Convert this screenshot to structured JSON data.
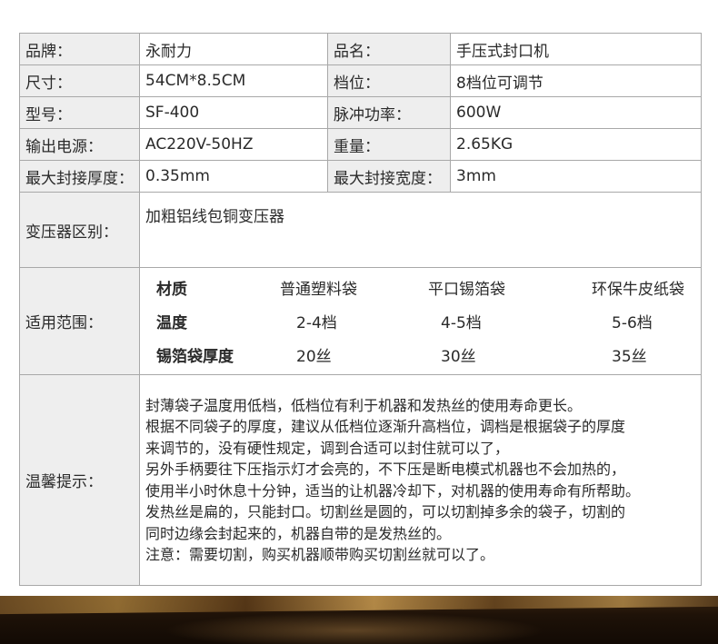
{
  "specs": {
    "rows": [
      {
        "label1": "品牌：",
        "value1": "永耐力",
        "label2": "品名：",
        "value2": "手压式封口机"
      },
      {
        "label1": "尺寸：",
        "value1": "54CM*8.5CM",
        "label2": "档位：",
        "value2": "8档位可调节"
      },
      {
        "label1": "型号：",
        "value1": "SF-400",
        "label2": "脉冲功率：",
        "value2": "600W"
      },
      {
        "label1": "输出电源：",
        "value1": "AC220V-50HZ",
        "label2": "重量：",
        "value2": "2.65KG"
      },
      {
        "label1": "最大封接厚度：",
        "value1": "0.35mm",
        "label2": "最大封接宽度：",
        "value2": "3mm"
      }
    ],
    "transformer": {
      "label": "变压器区别：",
      "value": "加粗铝线包铜变压器"
    },
    "range": {
      "label": "适用范围：",
      "header": [
        "材质",
        "普通塑料袋",
        "平口锡箔袋",
        "环保牛皮纸袋"
      ],
      "temp": [
        "温度",
        "2-4档",
        "4-5档",
        "5-6档"
      ],
      "thickness": [
        "锡箔袋厚度",
        "20丝",
        "30丝",
        "35丝"
      ]
    },
    "tips": {
      "label": "温馨提示：",
      "lines": [
        "封薄袋子温度用低档，低档位有利于机器和发热丝的使用寿命更长。",
        "根据不同袋子的厚度，建议从低档位逐渐升高档位，调档是根据袋子的厚度",
        "来调节的，没有硬性规定，调到合适可以封住就可以了，",
        "另外手柄要往下压指示灯才会亮的，不下压是断电模式机器也不会加热的，",
        "使用半小时休息十分钟，适当的让机器冷却下，对机器的使用寿命有所帮助。",
        "发热丝是扁的，只能封口。切割丝是圆的，可以切割掉多余的袋子，切割的",
        "同时边缘会封起来的，机器自带的是发热丝的。",
        "注意：需要切割，购买机器顺带购买切割丝就可以了。"
      ]
    }
  }
}
